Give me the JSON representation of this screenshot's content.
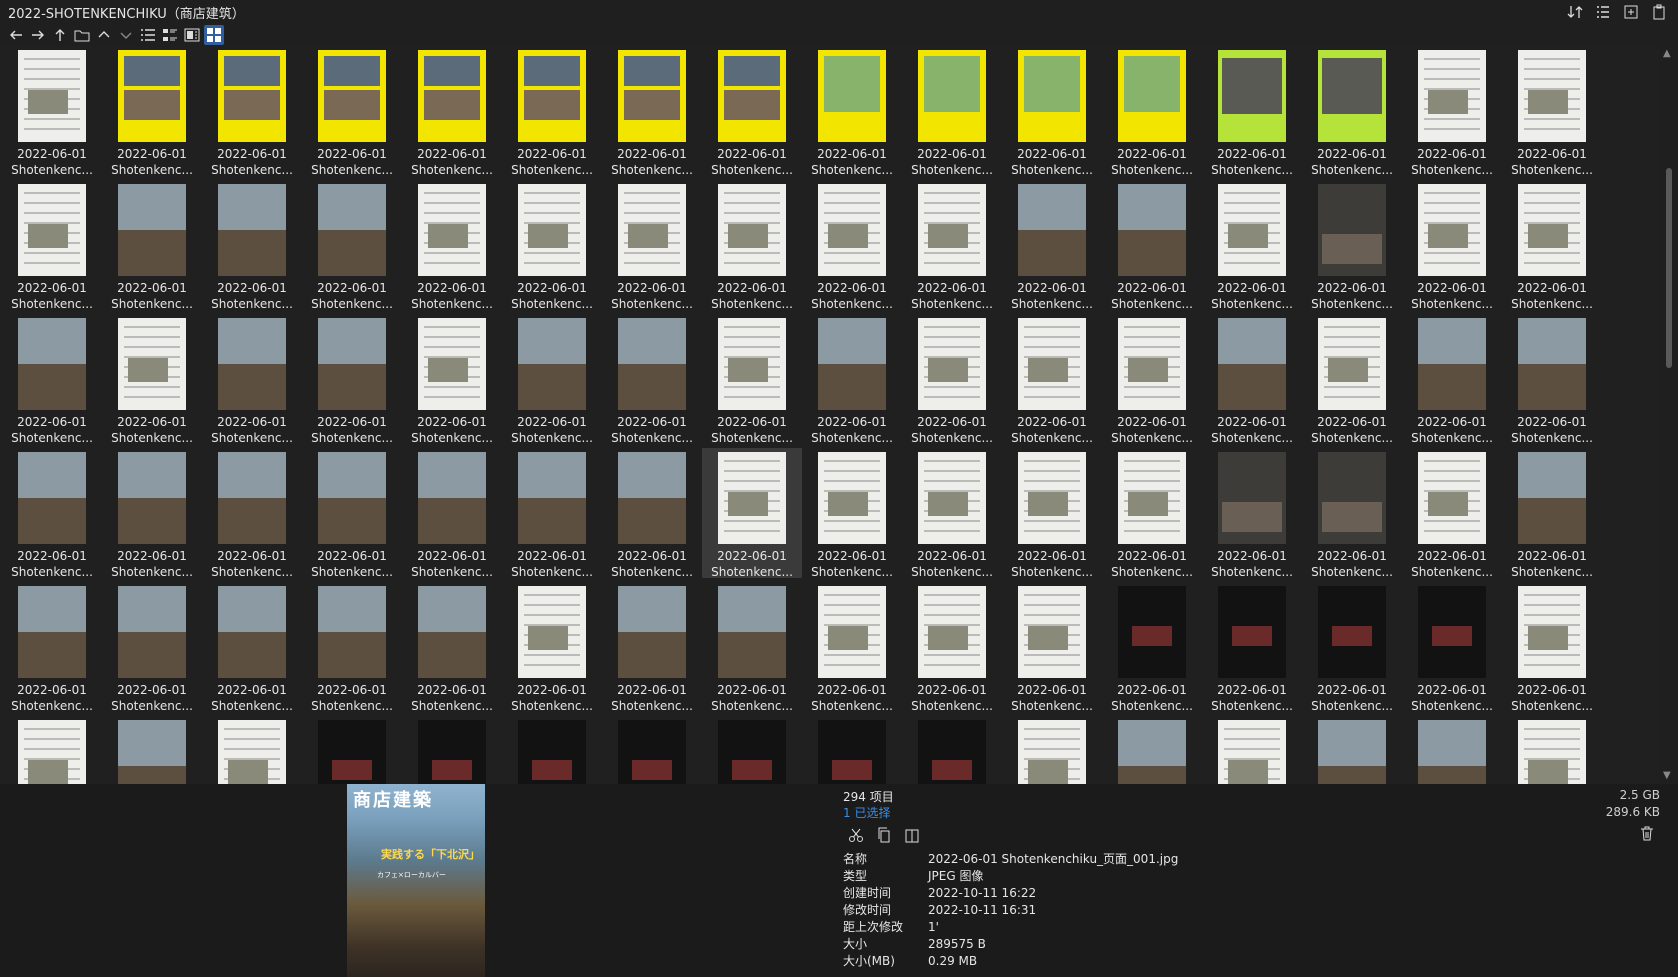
{
  "window": {
    "title": "2022-SHOTENKENCHIKU（商店建筑）",
    "actions": [
      "sort-icon",
      "details-view-icon",
      "new-window-icon",
      "clipboard-icon"
    ]
  },
  "toolbar": {
    "buttons": [
      "back-arrow-icon",
      "forward-arrow-icon",
      "up-arrow-icon",
      "folder-icon",
      "chevron-up-icon",
      "chevron-down-icon",
      "list-view-icon",
      "detail-view-icon",
      "preview-pane-icon",
      "thumbnail-view-icon"
    ],
    "active": "thumbnail-view-icon"
  },
  "grid": {
    "tile_line1": "2022-06-01",
    "tile_line2": "Shotenkenc...",
    "columns": 16,
    "rows": 6,
    "selected_index": 55
  },
  "statusbar": {
    "item_count": "294 项目",
    "selected_count": "1 已选择",
    "total_size": "2.5 GB",
    "selected_size": "289.6 KB"
  },
  "preview": {
    "cover_masthead": "商店建築",
    "cover_headline": "実践する「下北沢」",
    "cover_subline": "カフェ×ローカルバー"
  },
  "properties": [
    {
      "label": "名称",
      "value": "2022-06-01 Shotenkenchiku_页面_001.jpg"
    },
    {
      "label": "类型",
      "value": "JPEG 图像"
    },
    {
      "label": "创建时间",
      "value": "2022-10-11  16:22"
    },
    {
      "label": "修改时间",
      "value": "2022-10-11  16:31"
    },
    {
      "label": "距上次修改",
      "value": "1'"
    },
    {
      "label": "大小",
      "value": "289575 B"
    },
    {
      "label": "大小(MB)",
      "value": "0.29 MB"
    }
  ],
  "colors": {
    "background": "#1f1f1f",
    "accent": "#3a8ee6",
    "yellow_cover": "#f2e600",
    "green_cover": "#b6e33a"
  }
}
